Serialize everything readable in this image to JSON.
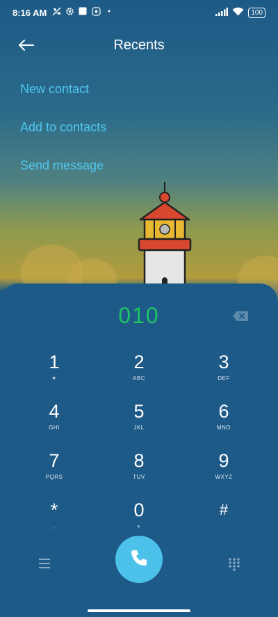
{
  "status": {
    "time": "8:16 AM",
    "battery": "100"
  },
  "header": {
    "title": "Recents"
  },
  "actions": {
    "new_contact": "New contact",
    "add_to_contacts": "Add to contacts",
    "send_message": "Send message"
  },
  "dialer": {
    "number": "010",
    "keys": [
      {
        "digit": "1",
        "letters": "⁕"
      },
      {
        "digit": "2",
        "letters": "ABC"
      },
      {
        "digit": "3",
        "letters": "DEF"
      },
      {
        "digit": "4",
        "letters": "GHI"
      },
      {
        "digit": "5",
        "letters": "JKL"
      },
      {
        "digit": "6",
        "letters": "MNO"
      },
      {
        "digit": "7",
        "letters": "PQRS"
      },
      {
        "digit": "8",
        "letters": "TUV"
      },
      {
        "digit": "9",
        "letters": "WXYZ"
      },
      {
        "digit": "*",
        "letters": ","
      },
      {
        "digit": "0",
        "letters": "+"
      },
      {
        "digit": "#",
        "letters": ""
      }
    ]
  },
  "colors": {
    "accent": "#4ec7ee",
    "number": "#1fc464",
    "pad_bg": "#1d5a88",
    "call_button": "#4cc1ea"
  },
  "icons": [
    "back-arrow-icon",
    "backspace-icon",
    "menu-icon",
    "phone-icon",
    "dialpad-icon",
    "wifi-icon",
    "signal-icon",
    "lighthouse-illustration"
  ]
}
